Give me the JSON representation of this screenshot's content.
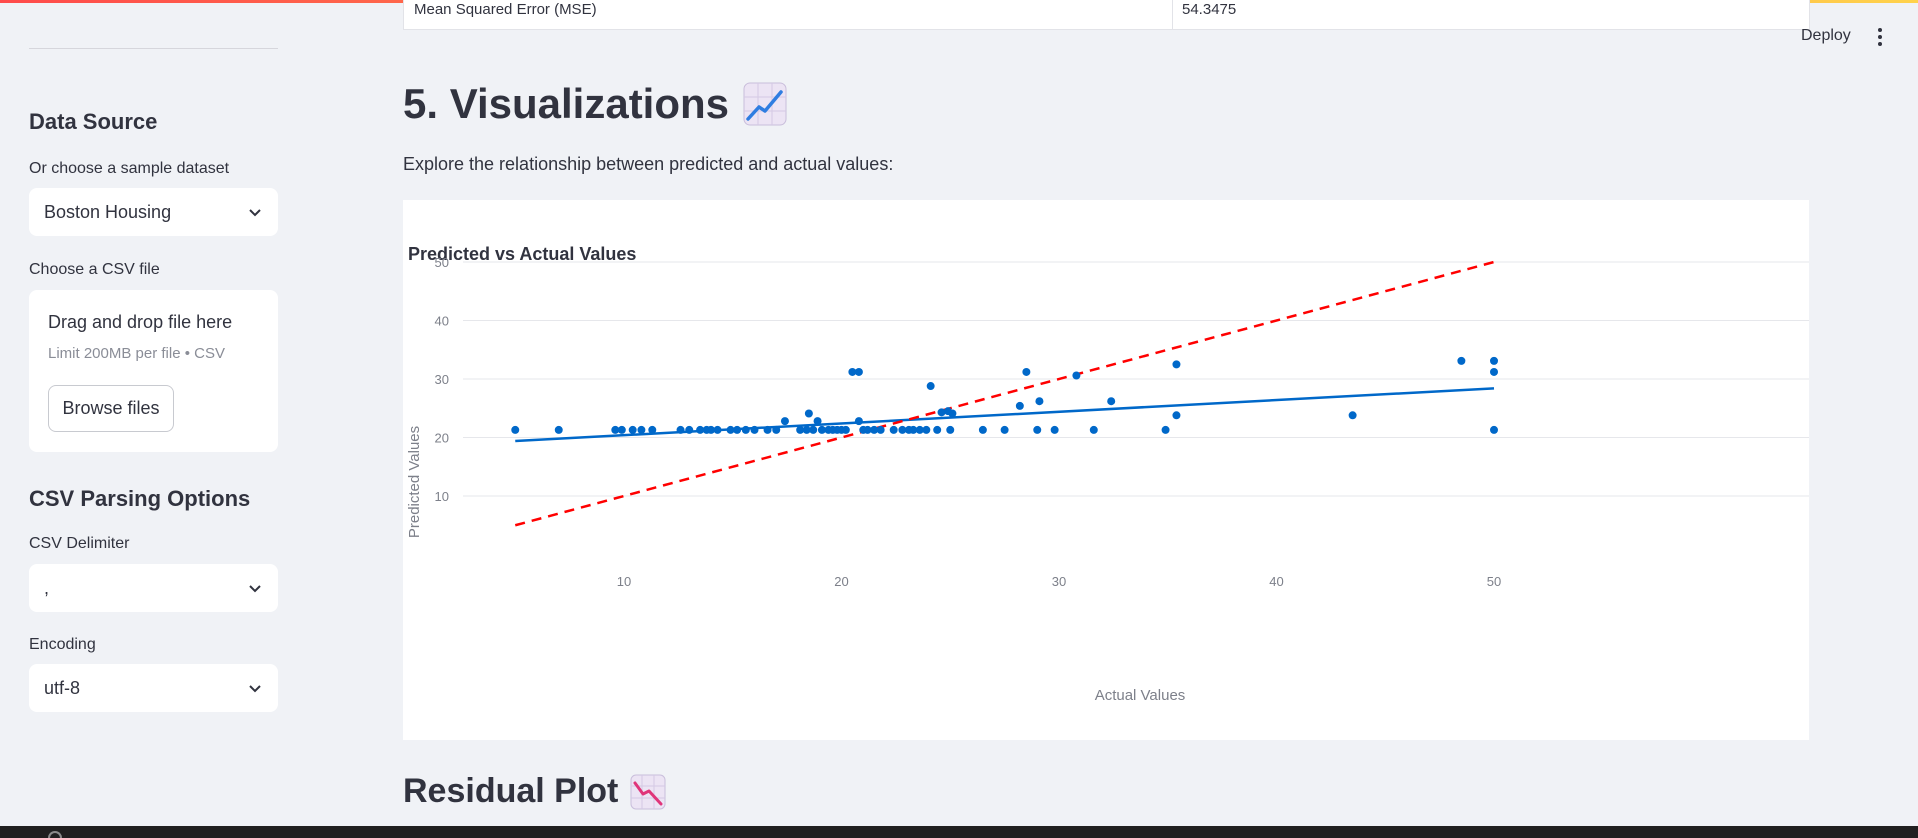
{
  "sidebar": {
    "data_source_heading": "Data Source",
    "sample_label": "Or choose a sample dataset",
    "sample_value": "Boston Housing",
    "csv_label": "Choose a CSV file",
    "drop_title": "Drag and drop file here",
    "drop_limit": "Limit 200MB per file • CSV",
    "browse_label": "Browse files",
    "csv_options_heading": "CSV Parsing Options",
    "delimiter_label": "CSV Delimiter",
    "delimiter_value": ",",
    "encoding_label": "Encoding",
    "encoding_value": "utf-8"
  },
  "header": {
    "deploy_label": "Deploy"
  },
  "metrics_row": {
    "metric": "Mean Squared Error (MSE)",
    "value": "54.3475"
  },
  "main": {
    "section_title": "5. Visualizations",
    "section_icon": "chart-increasing-icon",
    "subtext": "Explore the relationship between predicted and actual values:",
    "next_section_title": "Residual Plot",
    "next_section_icon": "chart-decreasing-icon"
  },
  "colors": {
    "accent": "#ff4b4b",
    "points": "#0068c9",
    "reference_line": "#ff0000",
    "background": "#f0f2f6"
  },
  "chart_data": {
    "type": "scatter",
    "title": "Predicted vs Actual Values",
    "xlabel": "Actual Values",
    "ylabel": "Predicted Values",
    "xlim": [
      3.5,
      52.7
    ],
    "ylim": [
      1.5,
      53
    ],
    "xticks": [
      10,
      20,
      30,
      40,
      50
    ],
    "yticks": [
      10,
      20,
      30,
      40,
      50
    ],
    "grid": true,
    "points": [
      [
        5.0,
        21.3
      ],
      [
        7.0,
        21.3
      ],
      [
        9.6,
        21.3
      ],
      [
        9.9,
        21.3
      ],
      [
        10.4,
        21.3
      ],
      [
        10.8,
        21.3
      ],
      [
        11.3,
        21.3
      ],
      [
        12.6,
        21.3
      ],
      [
        13.0,
        21.3
      ],
      [
        13.5,
        21.3
      ],
      [
        13.8,
        21.3
      ],
      [
        14.0,
        21.3
      ],
      [
        14.3,
        21.3
      ],
      [
        14.9,
        21.3
      ],
      [
        15.2,
        21.3
      ],
      [
        15.6,
        21.3
      ],
      [
        16.0,
        21.3
      ],
      [
        16.6,
        21.3
      ],
      [
        17.0,
        21.3
      ],
      [
        17.4,
        22.8
      ],
      [
        18.1,
        21.3
      ],
      [
        18.4,
        21.3
      ],
      [
        18.5,
        24.1
      ],
      [
        18.7,
        21.3
      ],
      [
        18.9,
        22.8
      ],
      [
        19.1,
        21.3
      ],
      [
        19.4,
        21.3
      ],
      [
        19.6,
        21.3
      ],
      [
        19.8,
        21.3
      ],
      [
        20.0,
        21.3
      ],
      [
        20.2,
        21.3
      ],
      [
        20.5,
        31.2
      ],
      [
        20.8,
        31.2
      ],
      [
        20.8,
        22.8
      ],
      [
        21.0,
        21.3
      ],
      [
        21.2,
        21.3
      ],
      [
        21.5,
        21.3
      ],
      [
        21.8,
        21.3
      ],
      [
        22.4,
        21.3
      ],
      [
        22.8,
        21.3
      ],
      [
        23.1,
        21.3
      ],
      [
        23.3,
        21.3
      ],
      [
        23.6,
        21.3
      ],
      [
        23.9,
        21.3
      ],
      [
        24.1,
        28.8
      ],
      [
        24.4,
        21.3
      ],
      [
        24.6,
        24.3
      ],
      [
        24.9,
        24.5
      ],
      [
        25.0,
        21.3
      ],
      [
        25.1,
        24.1
      ],
      [
        26.5,
        21.3
      ],
      [
        27.5,
        21.3
      ],
      [
        28.2,
        25.4
      ],
      [
        28.5,
        31.2
      ],
      [
        29.0,
        21.3
      ],
      [
        29.1,
        26.2
      ],
      [
        29.8,
        21.3
      ],
      [
        30.8,
        30.6
      ],
      [
        31.6,
        21.3
      ],
      [
        32.4,
        26.2
      ],
      [
        34.9,
        21.3
      ],
      [
        35.4,
        32.5
      ],
      [
        35.4,
        23.8
      ],
      [
        43.5,
        23.8
      ],
      [
        48.5,
        33.1
      ],
      [
        50.0,
        33.1
      ],
      [
        50.0,
        31.2
      ],
      [
        50.0,
        21.3
      ]
    ],
    "trend_line": {
      "x": [
        5,
        50
      ],
      "y": [
        19.4,
        28.4
      ]
    },
    "reference_line": {
      "x": [
        5,
        50
      ],
      "y": [
        5,
        50
      ]
    }
  }
}
